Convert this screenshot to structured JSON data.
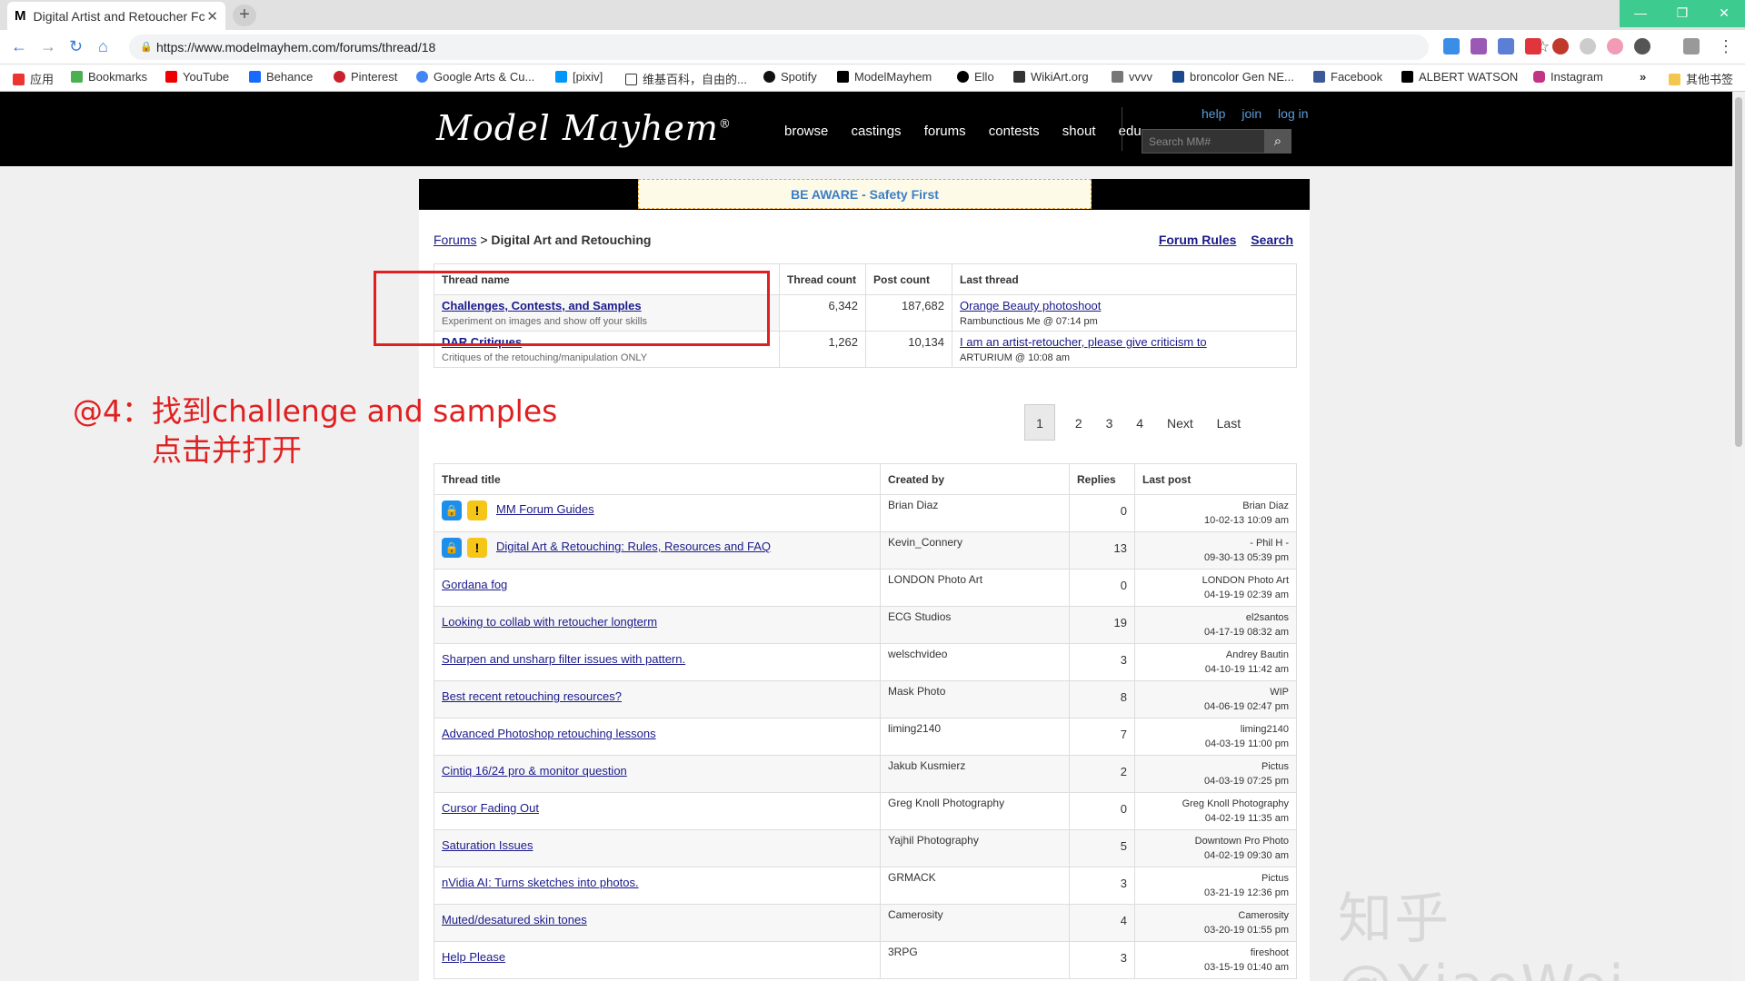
{
  "browser": {
    "tab_title": "Digital Artist and Retoucher Fc",
    "tab_favicon": "M",
    "url": "https://www.modelmayhem.com/forums/thread/18",
    "bookmarks": [
      "应用",
      "Bookmarks",
      "YouTube",
      "Behance",
      "Pinterest",
      "Google Arts & Cu...",
      "[pixiv]",
      "维基百科，自由的...",
      "Spotify",
      "ModelMayhem",
      "Ello",
      "WikiArt.org",
      "vvvv",
      "broncolor Gen NE...",
      "Facebook",
      "ALBERT WATSON",
      "Instagram",
      "»",
      "其他书签"
    ]
  },
  "site": {
    "logo": "Model Mayhem",
    "nav": [
      "browse",
      "castings",
      "forums",
      "contests",
      "shout",
      "edu"
    ],
    "top_links": [
      "help",
      "join",
      "log in"
    ],
    "search_placeholder": "Search MM#",
    "banner": "BE AWARE - Safety First"
  },
  "breadcrumb": {
    "root": "Forums",
    "sep": ">",
    "current": "Digital Art and Retouching"
  },
  "right_links": [
    "Forum Rules",
    "Search"
  ],
  "categories": {
    "headers": [
      "Thread name",
      "Thread count",
      "Post count",
      "Last thread"
    ],
    "rows": [
      {
        "name": "Challenges, Contests, and Samples",
        "desc": "Experiment on images and show off your skills",
        "threads": "6,342",
        "posts": "187,682",
        "last": "Orange Beauty photoshoot",
        "by": "Rambunctious Me @ 07:14 pm"
      },
      {
        "name": "DAR Critiques",
        "desc": "Critiques of the retouching/manipulation ONLY",
        "threads": "1,262",
        "posts": "10,134",
        "last": "I am an artist-retoucher, please give criticism to",
        "by": "ARTURIUM @ 10:08 am"
      }
    ]
  },
  "pager": [
    "1",
    "2",
    "3",
    "4",
    "Next",
    "Last"
  ],
  "threads": {
    "headers": [
      "Thread title",
      "Created by",
      "Replies",
      "Last post"
    ],
    "rows": [
      {
        "title": "MM Forum Guides",
        "by": "Brian Diaz",
        "replies": "0",
        "lp_user": "Brian Diaz",
        "lp_date": "10-02-13 10:09 am"
      },
      {
        "title": "Digital Art & Retouching: Rules, Resources and FAQ",
        "by": "Kevin_Connery",
        "replies": "13",
        "lp_user": "- Phil H -",
        "lp_date": "09-30-13 05:39 pm"
      },
      {
        "title": "Gordana fog",
        "by": "LONDON Photo Art",
        "replies": "0",
        "lp_user": "LONDON Photo Art",
        "lp_date": "04-19-19 02:39 am"
      },
      {
        "title": "Looking to collab with retoucher longterm",
        "by": "ECG Studios",
        "replies": "19",
        "lp_user": "el2santos",
        "lp_date": "04-17-19 08:32 am"
      },
      {
        "title": "Sharpen and unsharp filter issues with pattern.",
        "by": "welschvideo",
        "replies": "3",
        "lp_user": "Andrey Bautin",
        "lp_date": "04-10-19 11:42 am"
      },
      {
        "title": "Best recent retouching resources?",
        "by": "Mask Photo",
        "replies": "8",
        "lp_user": "WIP",
        "lp_date": "04-06-19 02:47 pm"
      },
      {
        "title": "Advanced Photoshop retouching lessons",
        "by": "liming2140",
        "replies": "7",
        "lp_user": "liming2140",
        "lp_date": "04-03-19 11:00 pm"
      },
      {
        "title": "Cintiq 16/24 pro & monitor question",
        "by": "Jakub Kusmierz",
        "replies": "2",
        "lp_user": "Pictus",
        "lp_date": "04-03-19 07:25 pm"
      },
      {
        "title": "Cursor Fading Out",
        "by": "Greg Knoll Photography",
        "replies": "0",
        "lp_user": "Greg Knoll Photography",
        "lp_date": "04-02-19 11:35 am"
      },
      {
        "title": "Saturation Issues",
        "by": "Yajhil Photography",
        "replies": "5",
        "lp_user": "Downtown Pro Photo",
        "lp_date": "04-02-19 09:30 am"
      },
      {
        "title": "nVidia AI: Turns sketches into photos.",
        "by": "GRMACK",
        "replies": "3",
        "lp_user": "Pictus",
        "lp_date": "03-21-19 12:36 pm"
      },
      {
        "title": "Muted/desatured skin tones",
        "by": "Camerosity",
        "replies": "4",
        "lp_user": "Camerosity",
        "lp_date": "03-20-19 01:55 pm"
      },
      {
        "title": "Help Please",
        "by": "3RPG",
        "replies": "3",
        "lp_user": "fireshoot",
        "lp_date": "03-15-19 01:40 am"
      }
    ]
  },
  "annotation": {
    "line1": "@4：找到challenge and samples",
    "line2": "点击并打开"
  },
  "watermark": "知乎 @XiaoWei"
}
